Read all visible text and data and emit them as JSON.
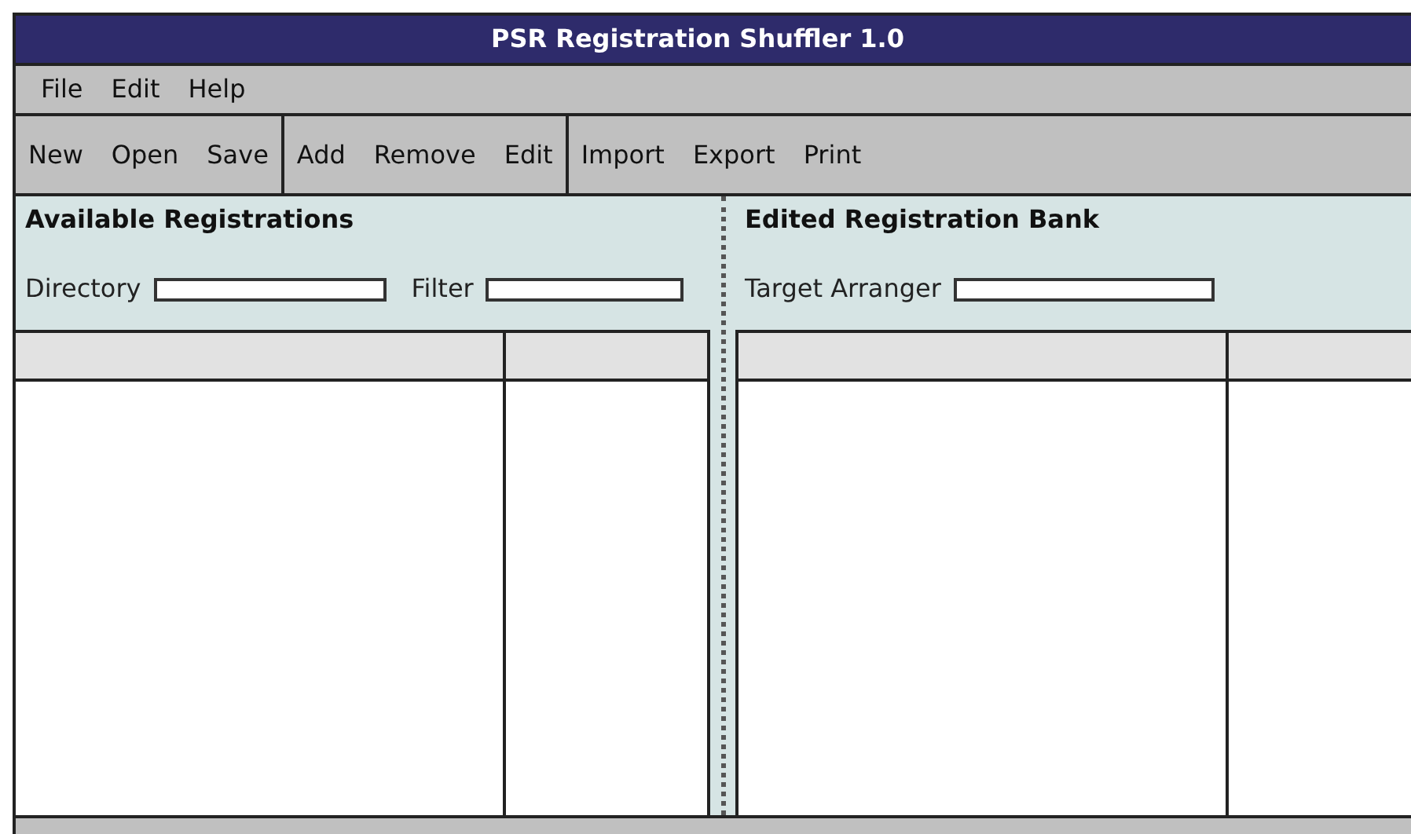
{
  "window": {
    "title": "PSR Registration Shuffler 1.0"
  },
  "menu": [
    "File",
    "Edit",
    "Help"
  ],
  "toolbar": [
    [
      "New",
      "Open",
      "Save"
    ],
    [
      "Add",
      "Remove",
      "Edit"
    ],
    [
      "Import",
      "Export",
      "Print"
    ]
  ],
  "left_panel": {
    "heading": "Available Registrations",
    "fields": [
      {
        "label": "Directory"
      },
      {
        "label": "Filter"
      }
    ]
  },
  "right_panel": {
    "heading": "Edited Registration Bank",
    "fields": [
      {
        "label": "Target Arranger"
      }
    ]
  }
}
